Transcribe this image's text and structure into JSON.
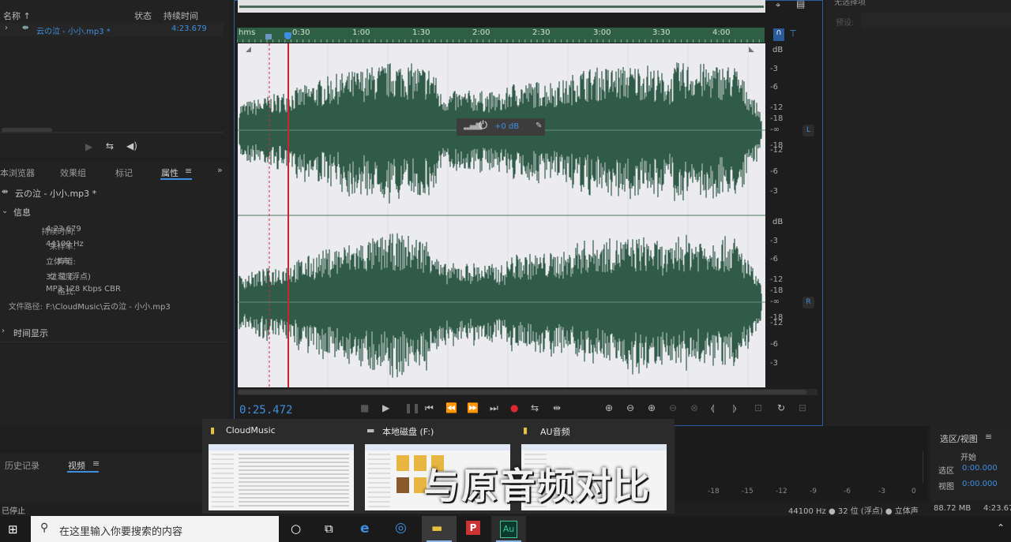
{
  "files": {
    "col_name": "名称 ↑",
    "col_status": "状态",
    "col_duration": "持续时间",
    "file_name": "云の泣 - 小小.mp3 *",
    "file_duration": "4:23.679"
  },
  "props": {
    "tabs": [
      "本浏览器",
      "效果组",
      "标记",
      "属性"
    ],
    "menu_icon": "≡",
    "more_icon": "»",
    "title": "云の泣 - 小小.mp3 *",
    "section_info": "信息",
    "info": [
      {
        "label": "持续时间:",
        "value": "4:23.679"
      },
      {
        "label": "采样率:",
        "value": "44100 Hz"
      },
      {
        "label": "声道:",
        "value": "立体声"
      },
      {
        "label": "位深度:",
        "value": "32 位 (浮点)"
      },
      {
        "label": "格式:",
        "value": "MP3 128 Kbps CBR"
      },
      {
        "label": "文件路径:",
        "value": "F:\\CloudMusic\\云の泣 - 小小.mp3"
      }
    ],
    "section_time": "时间显示"
  },
  "editor": {
    "time_display": "0:25.472",
    "ruler_labels": [
      "hms",
      "0:30",
      "1:00",
      "1:30",
      "2:00",
      "2:30",
      "3:00",
      "3:30",
      "4:00"
    ],
    "db_unit": "dB",
    "db_ticks_top": [
      "-3",
      "-6",
      "-12",
      "-18",
      "-∞",
      "-18",
      "-12",
      "-6",
      "-3"
    ],
    "db_ticks_bottom": [
      "-3",
      "-6",
      "-12",
      "-18",
      "-∞",
      "-18",
      "-12",
      "-6",
      "-3"
    ],
    "channel_l": "L",
    "channel_r": "R",
    "hud_gain": "+0 dB",
    "playhead_fraction": 0.096
  },
  "rightpanel": {
    "title_partial": "无选择项",
    "preset_label": "预设:"
  },
  "bottom": {
    "history_tab": "历史记录",
    "video_tab": "视频",
    "status_left": "已停止",
    "status_right": "44100 Hz ● 32 位 (浮点) ● 立体声",
    "disk_free": "88.72 MB",
    "duration_right": "4:23.67",
    "selview_title": "选区/视图",
    "selview_col": "开始",
    "sel_label": "选区",
    "sel_value": "0:00.000",
    "view_label": "视图",
    "view_value": "0:00.000",
    "meter_ticks": [
      "-18",
      "-15",
      "-12",
      "-9",
      "-6",
      "-3",
      "0"
    ]
  },
  "thumbs": [
    {
      "title": "CloudMusic",
      "icon": "folder-icon"
    },
    {
      "title": "本地磁盘 (F:)",
      "icon": "drive-icon"
    },
    {
      "title": "AU音频",
      "icon": "folder-icon"
    }
  ],
  "subtitle": "与原音频对比",
  "taskbar": {
    "search_placeholder": "在这里输入你要搜索的内容"
  },
  "colors": {
    "waveform": "#2f5b48",
    "accent_blue": "#3f8fe0",
    "playhead": "#d0202a",
    "timeline": "#2e5e44"
  }
}
